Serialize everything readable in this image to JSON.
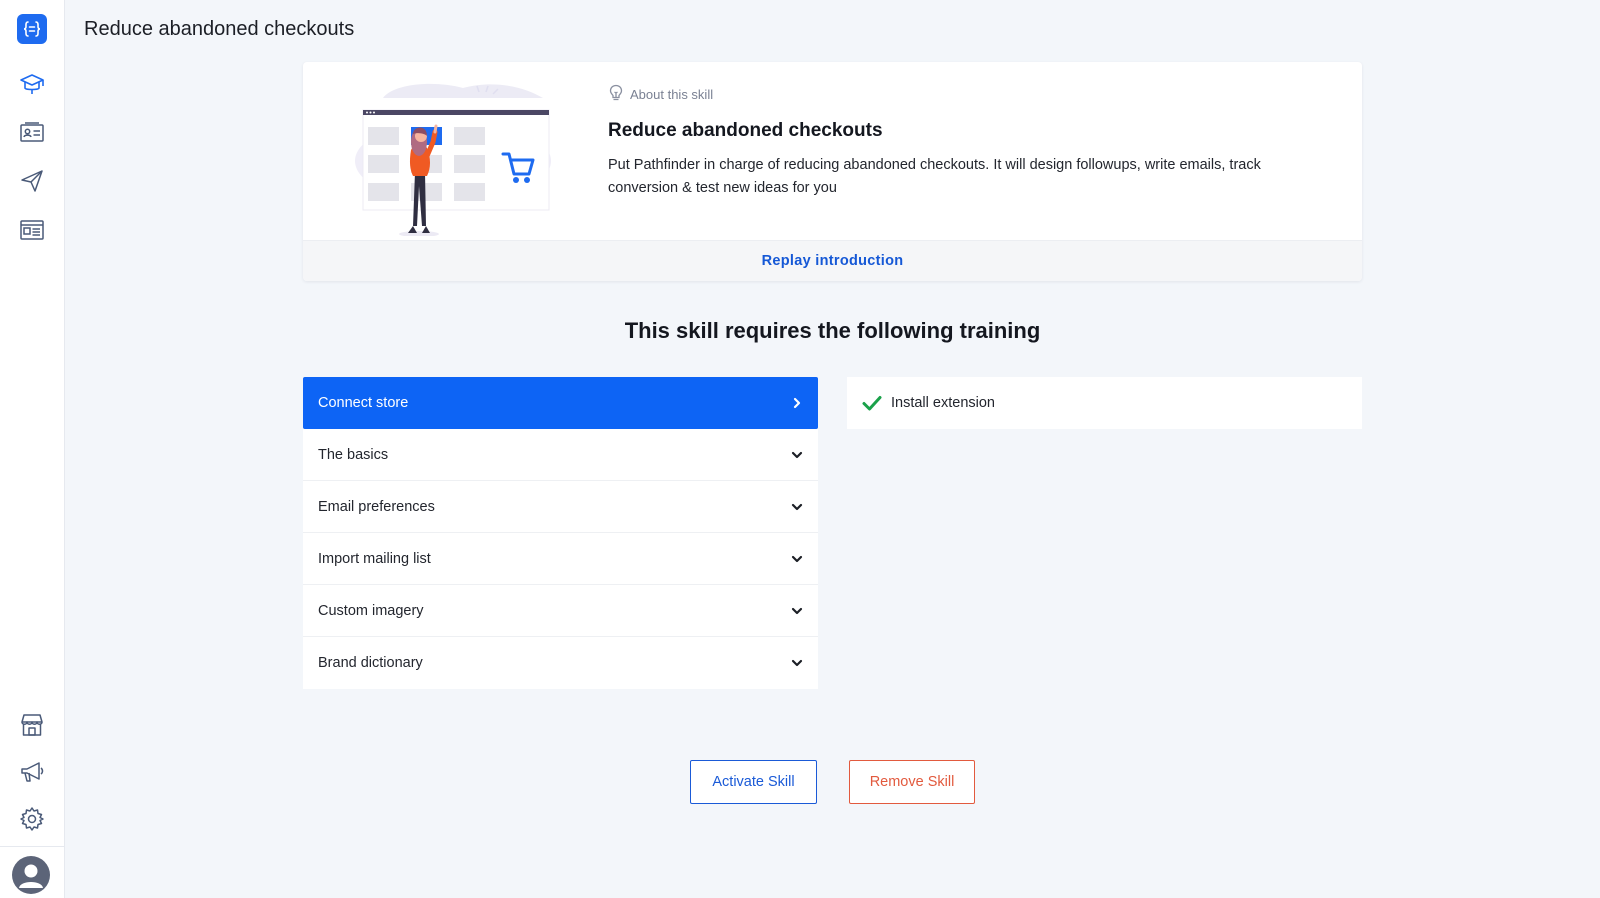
{
  "header": {
    "title": "Reduce abandoned checkouts"
  },
  "sidebar": {
    "top_items": [
      {
        "icon": "logo-braces-icon"
      },
      {
        "icon": "graduation-cap-icon"
      },
      {
        "icon": "contact-card-icon"
      },
      {
        "icon": "paper-plane-icon"
      },
      {
        "icon": "newspaper-icon"
      }
    ],
    "bottom_items": [
      {
        "icon": "storefront-icon"
      },
      {
        "icon": "megaphone-icon"
      },
      {
        "icon": "gear-icon"
      },
      {
        "icon": "user-avatar-icon"
      }
    ]
  },
  "about": {
    "label": "About this skill",
    "title": "Reduce abandoned checkouts",
    "description": "Put Pathfinder in charge of reducing abandoned checkouts. It will design followups, write emails, track conversion & test new ideas for you",
    "replay_label": "Replay introduction"
  },
  "training": {
    "heading": "This skill requires the following training",
    "items": [
      {
        "label": "Connect store",
        "active": true
      },
      {
        "label": "The basics"
      },
      {
        "label": "Email preferences"
      },
      {
        "label": "Import mailing list"
      },
      {
        "label": "Custom imagery"
      },
      {
        "label": "Brand dictionary"
      }
    ],
    "tasks": [
      {
        "label": "Install extension",
        "done": true
      }
    ]
  },
  "actions": {
    "activate_label": "Activate Skill",
    "remove_label": "Remove Skill"
  },
  "colors": {
    "accent": "#0d64f5",
    "danger": "#e25a3e",
    "success": "#1aa14a",
    "background": "#f3f6fa"
  }
}
